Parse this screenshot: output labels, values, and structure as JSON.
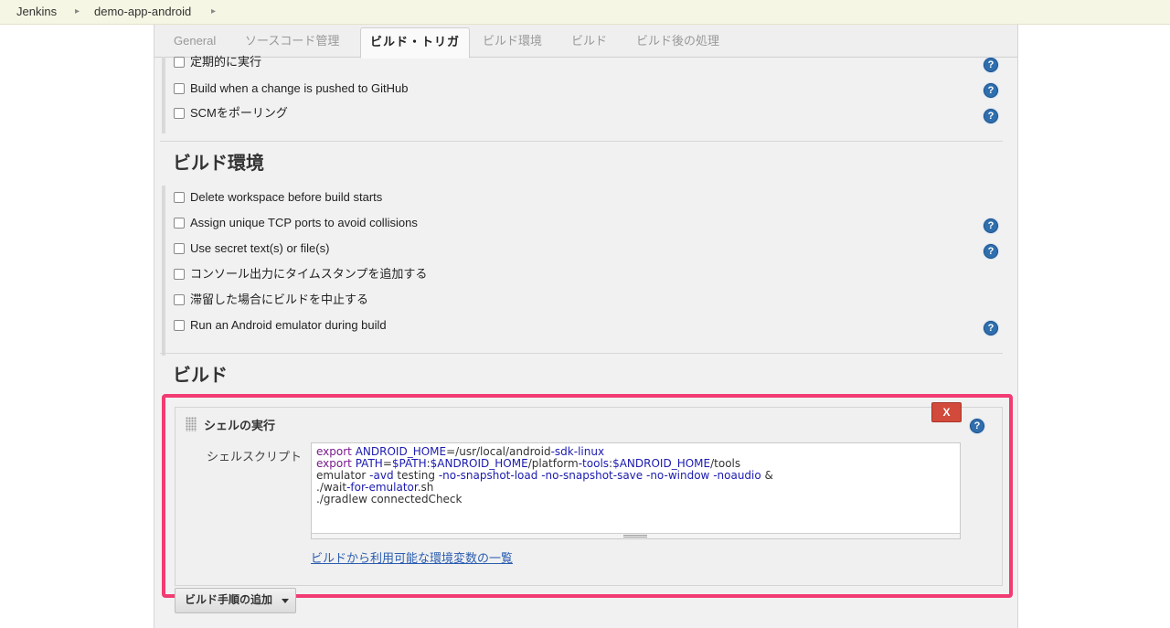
{
  "breadcrumb": {
    "items": [
      "Jenkins",
      "demo-app-android"
    ]
  },
  "tabs": [
    {
      "label": "General",
      "active": false
    },
    {
      "label": "ソースコード管理",
      "active": false
    },
    {
      "label": "ビルド・トリガ",
      "active": true
    },
    {
      "label": "ビルド環境",
      "active": false
    },
    {
      "label": "ビルド",
      "active": false
    },
    {
      "label": "ビルド後の処理",
      "active": false
    }
  ],
  "triggers": {
    "items": [
      {
        "label": "定期的に実行",
        "checked": false,
        "help": true
      },
      {
        "label": "Build when a change is pushed to GitHub",
        "checked": false,
        "help": true
      },
      {
        "label": "SCMをポーリング",
        "checked": false,
        "help": true
      }
    ]
  },
  "build_env": {
    "title": "ビルド環境",
    "items": [
      {
        "label": "Delete workspace before build starts",
        "checked": false,
        "help": false
      },
      {
        "label": "Assign unique TCP ports to avoid collisions",
        "checked": false,
        "help": true
      },
      {
        "label": "Use secret text(s) or file(s)",
        "checked": false,
        "help": true
      },
      {
        "label": "コンソール出力にタイムスタンプを追加する",
        "checked": false,
        "help": false
      },
      {
        "label": "滞留した場合にビルドを中止する",
        "checked": false,
        "help": false
      },
      {
        "label": "Run an Android emulator during build",
        "checked": false,
        "help": true
      }
    ]
  },
  "build": {
    "title": "ビルド",
    "step": {
      "title": "シェルの実行",
      "delete_label": "X",
      "field_label": "シェルスクリプト",
      "script_lines": [
        "export ANDROID_HOME=/usr/local/android-sdk-linux",
        "export PATH=$PATH:$ANDROID_HOME/platform-tools:$ANDROID_HOME/tools",
        "emulator -avd testing -no-snapshot-load -no-snapshot-save -no-window -noaudio &",
        "./wait-for-emulator.sh",
        "./gradlew connectedCheck"
      ],
      "env_link": "ビルドから利用可能な環境変数の一覧"
    },
    "add_step_label": "ビルド手順の追加"
  },
  "icons": {
    "help": "question-help-icon",
    "grip": "drag-handle-icon",
    "caret": "chevron-down-icon"
  },
  "colors": {
    "highlight": "#f23b72",
    "delete": "#d24a3b",
    "link": "#2a5db0",
    "help": "#2f6fae"
  }
}
